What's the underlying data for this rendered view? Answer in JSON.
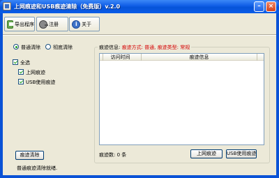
{
  "window": {
    "title": "上网痕迹和USB痕迹清除（免费版）v.2.0",
    "minimize_glyph": "–",
    "close_glyph": "×"
  },
  "toolbar": {
    "export_label": "导出程序",
    "register_label": "注册",
    "about_label": "关于"
  },
  "options": {
    "mode_normal": "普通清除",
    "mode_thorough": "彻底清除",
    "select_all": "全选",
    "net_traces": "上网痕迹",
    "usb_traces": "USB使用痕迹"
  },
  "trace_info": {
    "prefix": "痕迹信息:",
    "detail": "痕迹方式: 普通, 痕迹类型: 常规",
    "columns": [
      "访问时间",
      "痕迹信息"
    ],
    "count_label": "痕迹数: 0 条",
    "net_button": "上网痕迹",
    "usb_button": "USB使用痕迹"
  },
  "actions": {
    "clear_button": "痕迹清除"
  },
  "status": {
    "text": "普通痕迹清除就绪."
  },
  "colors": {
    "title_bar": "#0f5de6",
    "client_bg": "#ece9d8",
    "highlight_red": "#d40000"
  }
}
